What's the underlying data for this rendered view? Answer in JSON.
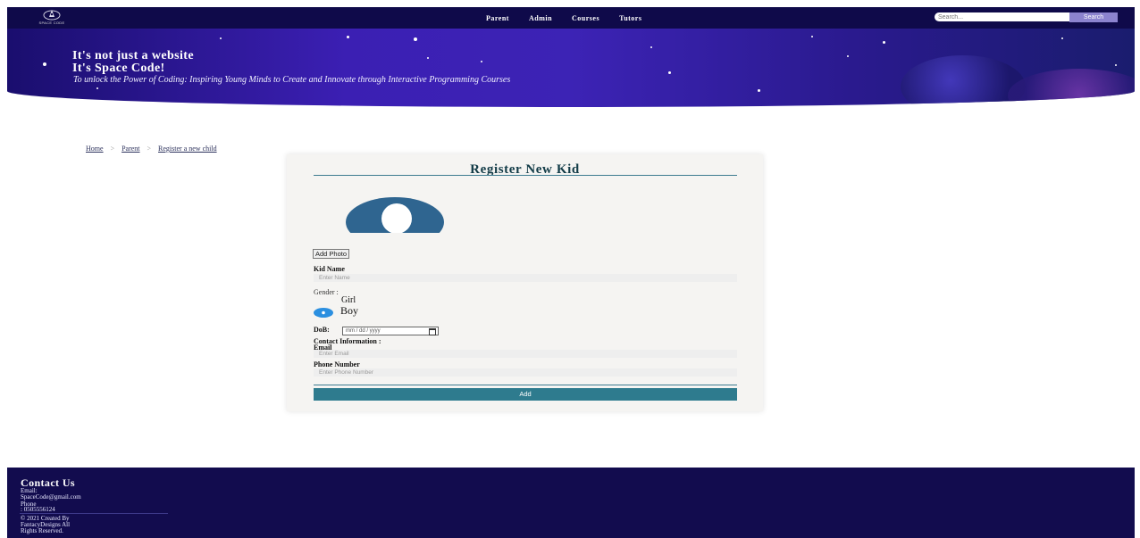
{
  "brand": {
    "logo_text": "SPACE CODE"
  },
  "nav": {
    "items": [
      "Parent",
      "Admin",
      "Courses",
      "Tutors"
    ],
    "search_placeholder": "Search...",
    "search_button": "Search"
  },
  "hero": {
    "headline_1": "It's not just a website",
    "headline_2": "It's Space Code!",
    "tagline": "To unlock the Power of Coding: Inspiring Young Minds to Create and Innovate through Interactive Programming Courses"
  },
  "breadcrumb": {
    "items": [
      "Home",
      "Parent",
      "Register a new child"
    ],
    "separator": ">"
  },
  "form": {
    "title": "Register New Kid",
    "add_photo_label": "Add Photo",
    "kid_name_label": "Kid Name",
    "kid_name_placeholder": "Enter Name",
    "gender_label": "Gender :",
    "gender_options": [
      "Girl",
      "Boy"
    ],
    "gender_selected": "Boy",
    "dob_label": "DoB:",
    "dob_placeholder": "mm / dd / yyyy",
    "contact_label": "Contact Information :",
    "email_label": "Email",
    "email_placeholder": "Enter Email",
    "phone_label": "Phone Number",
    "phone_placeholder": "Enter Phone Number",
    "submit_label": "Add"
  },
  "footer": {
    "title": "Contact Us",
    "email_label": "Email:",
    "email_value": "SpaceCode@gmail.com",
    "phone_label": "Phone",
    "phone_value": ": 0505556124",
    "copyright_1": "© 2021 Created By",
    "copyright_2": "FantacyDesigns All",
    "copyright_3": "Rights Reserved."
  },
  "colors": {
    "nav_bg": "#0f0a4a",
    "accent": "#2e7b8e",
    "title_color": "#123b47",
    "radio_selected": "#2b8fe0",
    "footer_bg": "#120c4e"
  }
}
